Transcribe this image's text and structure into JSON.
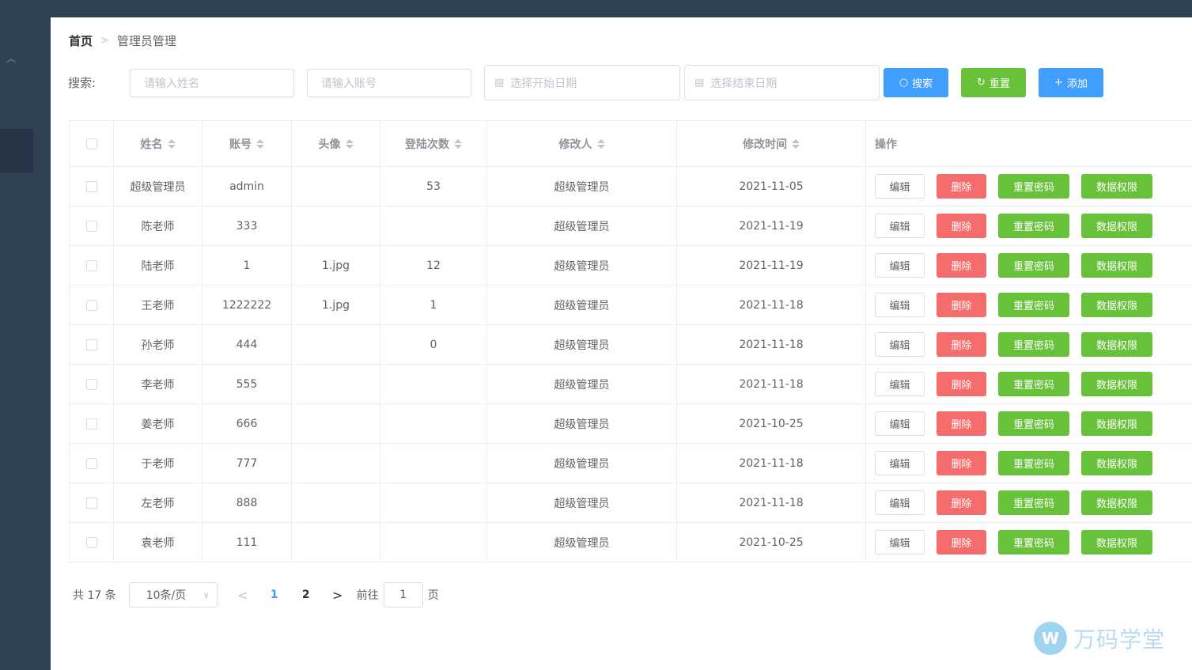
{
  "breadcrumb": {
    "home": "首页",
    "current": "管理员管理"
  },
  "search": {
    "label": "搜索:",
    "name_placeholder": "请输入姓名",
    "account_placeholder": "请输入账号",
    "start_date_placeholder": "选择开始日期",
    "end_date_placeholder": "选择结束日期",
    "search_label": "搜索",
    "reset_label": "重置",
    "add_label": "添加"
  },
  "table": {
    "headers": [
      "姓名",
      "账号",
      "头像",
      "登陆次数",
      "修改人",
      "修改时间",
      "操作"
    ],
    "actions": {
      "edit": "编辑",
      "delete": "删除",
      "reset_password": "重置密码",
      "data_permission": "数据权限"
    },
    "rows": [
      {
        "name": "超级管理员",
        "account": "admin",
        "avatar": "",
        "logins": "53",
        "modifier": "超级管理员",
        "modified": "2021-11-05"
      },
      {
        "name": "陈老师",
        "account": "333",
        "avatar": "",
        "logins": "",
        "modifier": "超级管理员",
        "modified": "2021-11-19"
      },
      {
        "name": "陆老师",
        "account": "1",
        "avatar": "1.jpg",
        "logins": "12",
        "modifier": "超级管理员",
        "modified": "2021-11-19"
      },
      {
        "name": "王老师",
        "account": "1222222",
        "avatar": "1.jpg",
        "logins": "1",
        "modifier": "超级管理员",
        "modified": "2021-11-18"
      },
      {
        "name": "孙老师",
        "account": "444",
        "avatar": "",
        "logins": "0",
        "modifier": "超级管理员",
        "modified": "2021-11-18"
      },
      {
        "name": "李老师",
        "account": "555",
        "avatar": "",
        "logins": "",
        "modifier": "超级管理员",
        "modified": "2021-11-18"
      },
      {
        "name": "姜老师",
        "account": "666",
        "avatar": "",
        "logins": "",
        "modifier": "超级管理员",
        "modified": "2021-10-25"
      },
      {
        "name": "于老师",
        "account": "777",
        "avatar": "",
        "logins": "",
        "modifier": "超级管理员",
        "modified": "2021-11-18"
      },
      {
        "name": "左老师",
        "account": "888",
        "avatar": "",
        "logins": "",
        "modifier": "超级管理员",
        "modified": "2021-11-18"
      },
      {
        "name": "袁老师",
        "account": "111",
        "avatar": "",
        "logins": "",
        "modifier": "超级管理员",
        "modified": "2021-10-25"
      }
    ]
  },
  "pagination": {
    "total_label": "共 17 条",
    "page_size_label": "10条/页",
    "pages": [
      "1",
      "2"
    ],
    "current_page": "1",
    "goto_label": "前往",
    "goto_value": "1",
    "page_suffix": "页"
  },
  "watermark": {
    "mark": "W",
    "text": "万码学堂"
  },
  "colors": {
    "sidebar": "#304156",
    "primary": "#409eff",
    "success": "#67c23a",
    "danger": "#f56c6c"
  }
}
